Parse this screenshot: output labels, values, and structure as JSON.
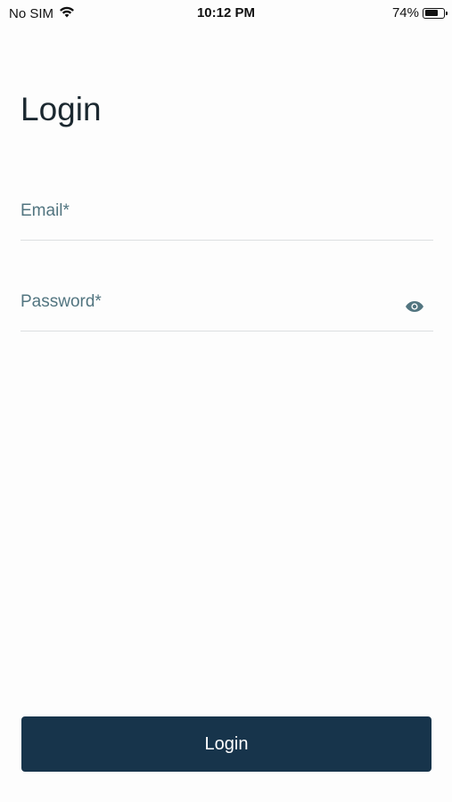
{
  "status_bar": {
    "carrier": "No SIM",
    "time": "10:12 PM",
    "battery_percent": "74%",
    "battery_level": 0.74
  },
  "page": {
    "title": "Login"
  },
  "form": {
    "email_label": "Email*",
    "email_value": "",
    "password_label": "Password*",
    "password_value": "",
    "password_toggle_icon": "eye-icon"
  },
  "actions": {
    "login_label": "Login"
  },
  "colors": {
    "primary": "#17344b",
    "label": "#527580",
    "divider": "#dcdfe1"
  }
}
